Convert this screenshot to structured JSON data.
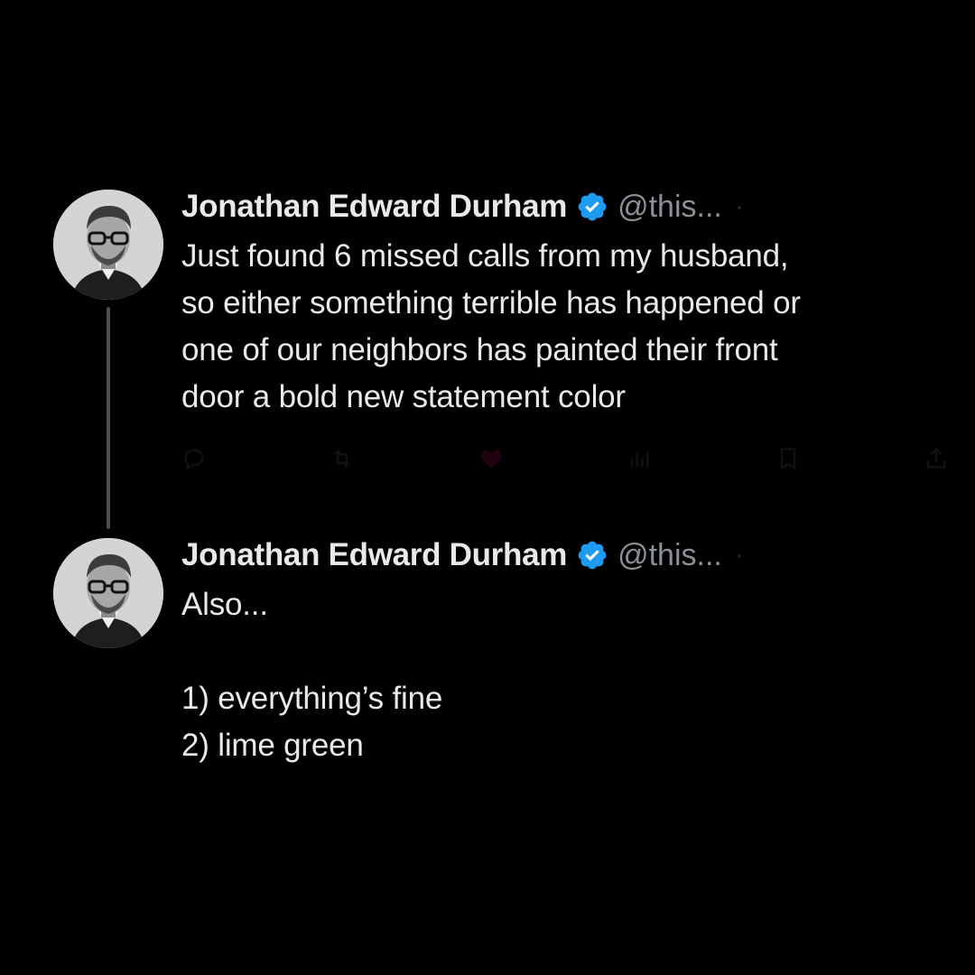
{
  "colors": {
    "background": "#000000",
    "text": "#e7e9ea",
    "handle": "#8b9096",
    "verified": "#1d9bf0",
    "thread_line": "#4a4d50"
  },
  "tweets": [
    {
      "display_name": "Jonathan Edward Durham",
      "verified_icon": "verified-badge-icon",
      "handle": "@this...",
      "text": "Just found 6 missed calls from my husband,\nso either something terrible has happened or\none of our neighbors has painted their front\ndoor a bold new statement color"
    },
    {
      "display_name": "Jonathan Edward Durham",
      "verified_icon": "verified-badge-icon",
      "handle": "@this...",
      "text": "Also...\n\n1) everything’s fine\n2) lime green"
    }
  ],
  "action_icons": [
    "reply-icon",
    "retweet-icon",
    "like-icon",
    "views-icon",
    "bookmark-icon",
    "share-icon"
  ]
}
